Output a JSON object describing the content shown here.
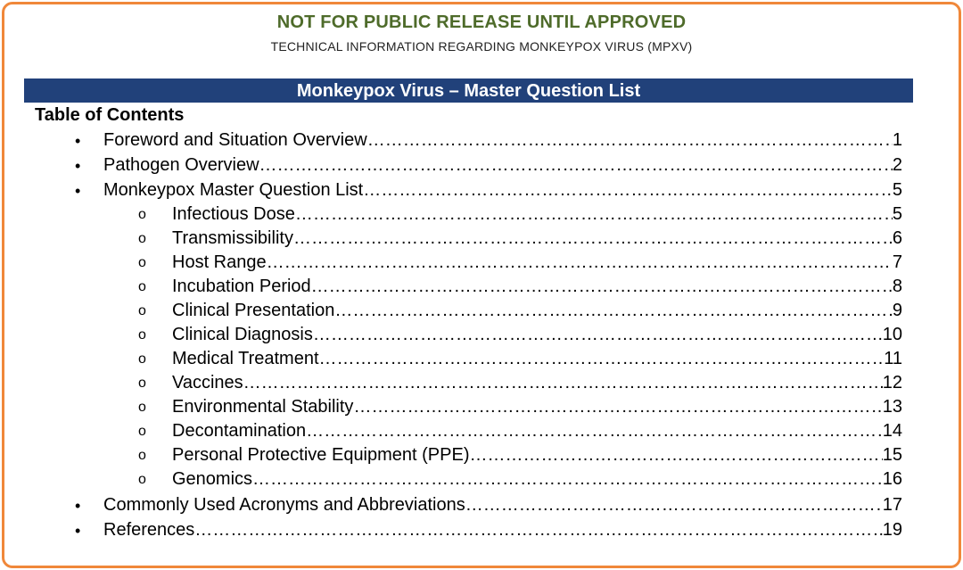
{
  "header": {
    "notice": "NOT FOR PUBLIC RELEASE UNTIL APPROVED",
    "subtitle": "TECHNICAL INFORMATION REGARDING MONKEYPOX VIRUS (MPXV)"
  },
  "banner": {
    "title": "Monkeypox Virus – Master Question List"
  },
  "toc": {
    "title": "Table of Contents",
    "items": [
      {
        "label": "Foreword and Situation Overview",
        "page": "1"
      },
      {
        "label": "Pathogen Overview",
        "page": "2"
      },
      {
        "label": "Monkeypox Master Question List",
        "page": "5"
      },
      {
        "label": "Infectious Dose",
        "page": "5"
      },
      {
        "label": "Transmissibility",
        "page": "6"
      },
      {
        "label": "Host Range",
        "page": "7"
      },
      {
        "label": "Incubation Period",
        "page": "8"
      },
      {
        "label": "Clinical Presentation",
        "page": "9"
      },
      {
        "label": "Clinical Diagnosis",
        "page": "10"
      },
      {
        "label": "Medical Treatment",
        "page": "11"
      },
      {
        "label": "Vaccines",
        "page": "12"
      },
      {
        "label": "Environmental Stability",
        "page": "13"
      },
      {
        "label": "Decontamination",
        "page": "14"
      },
      {
        "label": "Personal Protective Equipment (PPE)",
        "page": "15"
      },
      {
        "label": "Genomics",
        "page": "16"
      },
      {
        "label": "Commonly Used Acronyms and Abbreviations",
        "page": "17"
      },
      {
        "label": "References",
        "page": "19"
      }
    ],
    "bullet_glyph": "•",
    "sub_bullet_glyph": "o"
  },
  "colors": {
    "frame": "#f0883a",
    "notice": "#4e6b2a",
    "banner": "#21417a"
  }
}
